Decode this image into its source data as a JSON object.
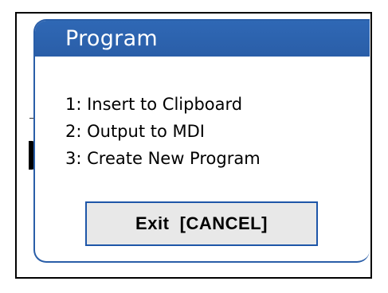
{
  "dialog": {
    "title": "Program",
    "options": [
      {
        "label": "1: Insert to Clipboard"
      },
      {
        "label": "2: Output to MDI"
      },
      {
        "label": "3: Create New Program"
      }
    ],
    "exit_button_label": "Exit  [CANCEL]"
  },
  "colors": {
    "header": "#2a5ea8",
    "border": "#2a5ea8",
    "button_bg": "#e8e8e8",
    "button_border": "#1e56a8"
  }
}
